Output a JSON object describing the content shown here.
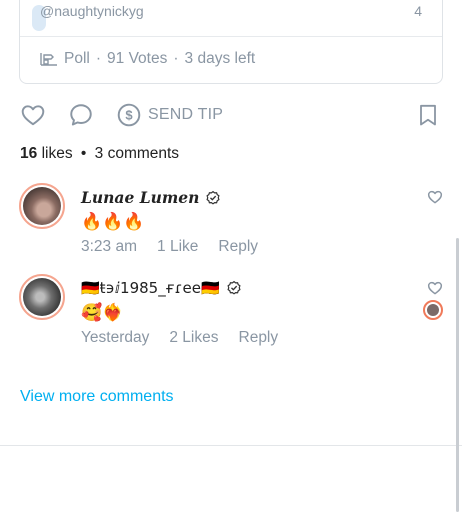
{
  "poll": {
    "option_text": "@naughtynickyg",
    "option_count": "4",
    "label": "Poll",
    "votes": "91 Votes",
    "time_left": "3 days left",
    "separator": "·"
  },
  "actions": {
    "send_tip_label": "SEND TIP"
  },
  "stats": {
    "likes_count": "16",
    "likes_word": "likes",
    "separator": "•",
    "comments": "3 comments"
  },
  "comments": [
    {
      "name": "Lunae Lumen",
      "text": "🔥🔥🔥",
      "time": "3:23 am",
      "likes": "1 Like",
      "reply": "Reply"
    },
    {
      "name": "🇩🇪ŧ϶ⅈ1985_ғɾee🇩🇪",
      "text": "🥰❤️‍🔥",
      "time": "Yesterday",
      "likes": "2 Likes",
      "reply": "Reply"
    }
  ],
  "view_more": "View more comments",
  "colors": {
    "accent": "#00aff0",
    "muted": "#8a96a3",
    "avatar_ring": "#f5a58f"
  }
}
